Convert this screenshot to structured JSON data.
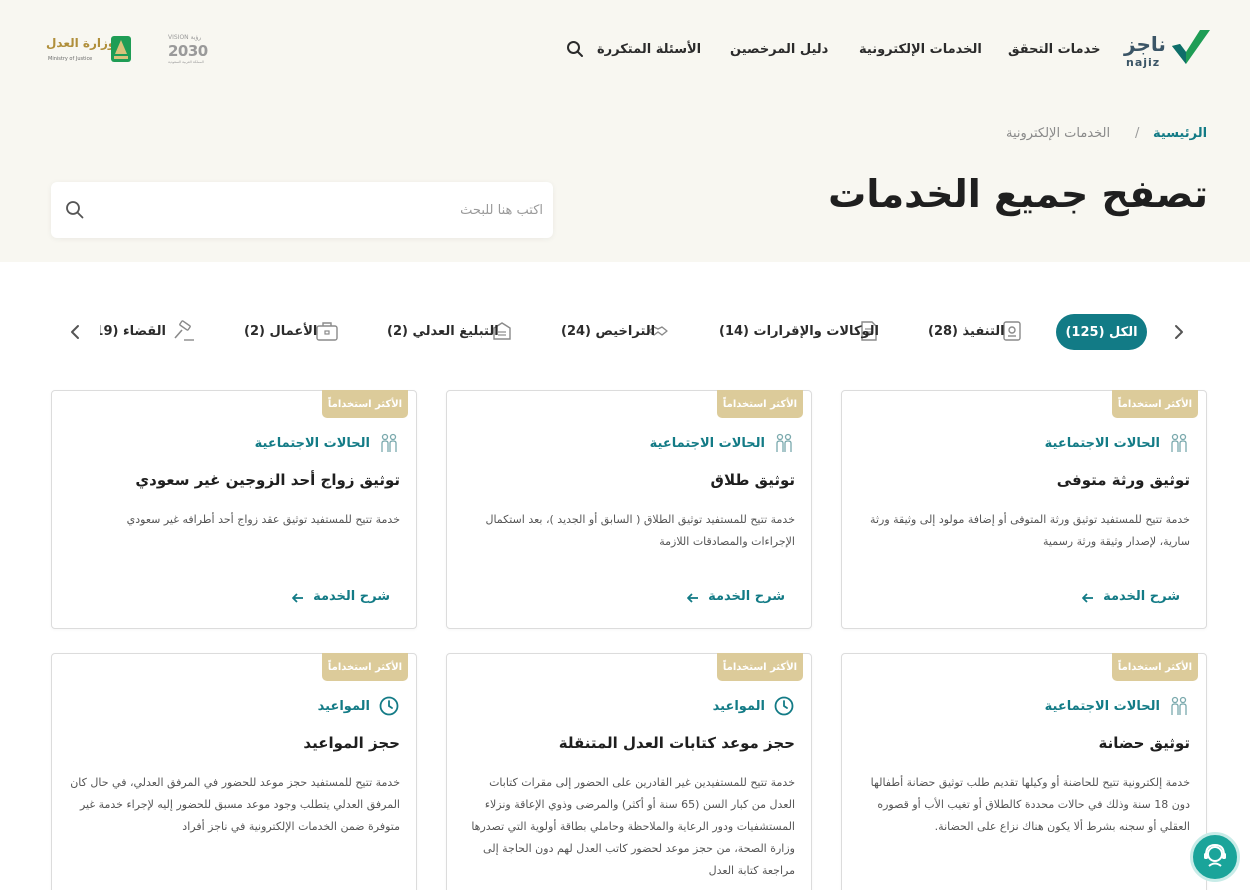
{
  "header": {
    "logo_ar": "ناجز",
    "logo_en": "najiz",
    "nav": [
      {
        "label": "خدمات التحقق"
      },
      {
        "label": "الخدمات الإلكترونية"
      },
      {
        "label": "دليل المرخصين"
      },
      {
        "label": "الأسئلة المتكررة"
      }
    ],
    "moj_ar": "وزارة العدل",
    "moj_en": "Ministry of Justice",
    "vision_top": "VISION رؤية",
    "vision_year": "2030",
    "vision_sub": "المملكة العربية السعودية"
  },
  "breadcrumb": {
    "home": "الرئيسية",
    "separator": "/",
    "current": "الخدمات الإلكترونية"
  },
  "page": {
    "title": "تصفح جميع الخدمات",
    "search_placeholder": "اكتب هنا للبحث"
  },
  "categories": [
    {
      "label": "الكل (125)",
      "active": true
    },
    {
      "label": "التنفيذ (28)",
      "icon": "execution-icon"
    },
    {
      "label": "الوكالات والإقرارات (14)",
      "icon": "document-icon"
    },
    {
      "label": "التراخيص (24)",
      "icon": "handshake-icon"
    },
    {
      "label": "التبليغ العدلي (2)",
      "icon": "notification-icon"
    },
    {
      "label": "الأعمال (2)",
      "icon": "briefcase-icon"
    },
    {
      "label": "القضاء (19)",
      "icon": "gavel-icon"
    }
  ],
  "cards": [
    {
      "badge": "الأكثر استخداماً",
      "category": "الحالات الاجتماعية",
      "title": "توثيق ورثة متوفى",
      "description": "خدمة تتيح للمستفيد توثيق ورثة المتوفى أو إضافة مولود إلى وثيقة ورثة سارية، لإصدار وثيقة ورثة رسمية",
      "link": "شرح الخدمة"
    },
    {
      "badge": "الأكثر استخداماً",
      "category": "الحالات الاجتماعية",
      "title": "توثيق طلاق",
      "description": "خدمة تتيح للمستفيد توثيق الطلاق ( السابق أو الجديد )، بعد استكمال الإجراءات والمصادقات اللازمة",
      "link": "شرح الخدمة"
    },
    {
      "badge": "الأكثر استخداماً",
      "category": "الحالات الاجتماعية",
      "title": "توثيق زواج أحد الزوجين غير سعودي",
      "description": "خدمة تتيح للمستفيد توثيق عقد زواج أحد أطرافه غير سعودي",
      "link": "شرح الخدمة"
    },
    {
      "badge": "الأكثر استخداماً",
      "category": "الحالات الاجتماعية",
      "title": "توثيق حضانة",
      "description": "خدمة إلكترونية تتيح للحاضنة أو وكيلها تقديم طلب توثيق حضانة أطفالها دون 18 سنة وذلك في حالات محددة كالطلاق أو تغيب الأب أو قصوره العقلي أو سجنه بشرط ألا يكون هناك نزاع على الحضانة.",
      "link": "شرح الخدمة"
    },
    {
      "badge": "الأكثر استخداماً",
      "category": "المواعيد",
      "title": "حجز موعد كتابات العدل المتنقلة",
      "description": "خدمة تتيح للمستفيدين غير القادرين على الحضور إلى مقرات كتابات العدل من كبار السن (65 سنة أو أكثر) والمرضى وذوي الإعاقة ونزلاء المستشفيات ودور الرعاية والملاحظة وحاملي بطاقة أولوية التي تصدرها وزارة الصحة، من حجز موعد لحضور كاتب العدل لهم دون الحاجة إلى مراجعة كتابة العدل",
      "link": "شرح الخدمة"
    },
    {
      "badge": "الأكثر استخداماً",
      "category": "المواعيد",
      "title": "حجز المواعيد",
      "description": "خدمة تتيح للمستفيد حجز موعد للحضور في المرفق العدلي، في حال كان المرفق العدلي يتطلب وجود موعد مسبق للحضور إليه لإجراء خدمة غير متوفرة ضمن الخدمات الإلكترونية في ناجز أفراد",
      "link": "شرح الخدمة"
    }
  ],
  "colors": {
    "primary": "#127b86",
    "badge": "#dccb9a",
    "hero_bg": "#f8f7f1",
    "logo_green": "#1f9d55",
    "fab": "#1aa49a"
  }
}
